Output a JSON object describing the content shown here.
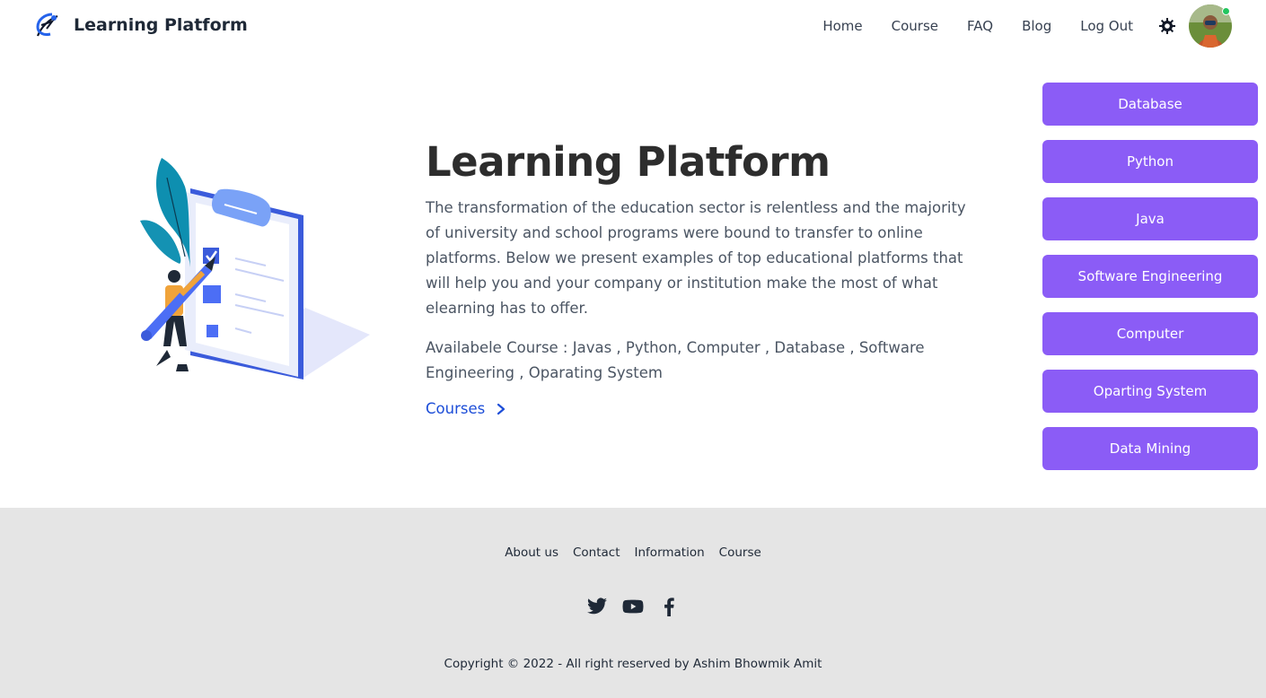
{
  "header": {
    "brand": "Learning Platform",
    "nav": [
      "Home",
      "Course",
      "FAQ",
      "Blog",
      "Log Out"
    ],
    "theme_icon": "gear-icon",
    "avatar_status_color": "#22c55e"
  },
  "hero": {
    "title": "Learning Platform",
    "description": "The transformation of the education sector is relentless and the majority of university and school programs were bound to transfer to online platforms. Below we present examples of top educational platforms that will help you and your company or institution make the most of what elearning has to offer.",
    "available_courses": "Availabele Course : Javas , Python, Computer , Database , Software Engineering , Oparating System",
    "courses_link": "Courses"
  },
  "categories": [
    "Database",
    "Python",
    "Java",
    "Software Engineering",
    "Computer",
    "Oparting System",
    "Data Mining"
  ],
  "footer": {
    "links": [
      "About us",
      "Contact",
      "Information",
      "Course"
    ],
    "social": [
      "twitter-icon",
      "youtube-icon",
      "facebook-icon"
    ],
    "copyright": "Copyright © 2022 - All right reserved by Ashim Bhowmik Amit"
  },
  "colors": {
    "accent": "#8b5cf6",
    "link": "#1d4ed8",
    "footer_bg": "#e5e5e5",
    "title": "#2d2d2d"
  }
}
